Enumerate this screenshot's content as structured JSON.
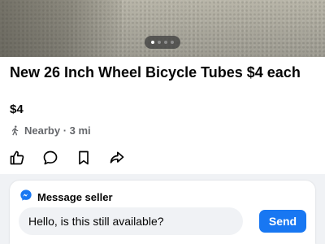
{
  "carousel": {
    "total_images": 4,
    "active_index": 0
  },
  "listing": {
    "title": "New 26 Inch Wheel Bicycle Tubes $4 each",
    "price": "$4",
    "location": "Nearby · 3 mi"
  },
  "actions": [
    "like-icon",
    "comment-icon",
    "save-icon",
    "share-icon"
  ],
  "message": {
    "header": "Message seller",
    "input_value": "Hello, is this still available?",
    "send_label": "Send"
  },
  "colors": {
    "accent": "#1877f2",
    "secondary_text": "#65676b",
    "panel_background": "#f0f2f5"
  }
}
